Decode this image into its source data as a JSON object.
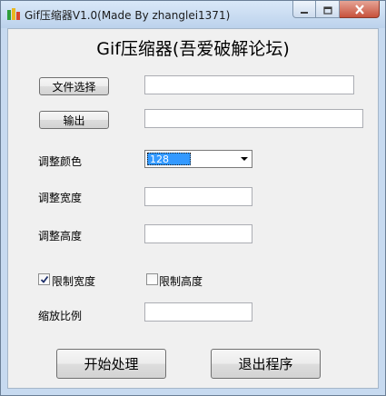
{
  "window": {
    "title": "Gif压缩器V1.0(Made By zhanglei1371)"
  },
  "heading": "Gif压缩器(吾爱破解论坛)",
  "buttons": {
    "select_file": "文件选择",
    "output": "输出",
    "start": "开始处理",
    "exit": "退出程序"
  },
  "fields": {
    "input_path": "",
    "output_path": "",
    "width": "",
    "height": "",
    "scale": ""
  },
  "labels": {
    "color": "调整颜色",
    "width": "调整宽度",
    "height": "调整高度",
    "scale": "缩放比例"
  },
  "color_select": {
    "value": "128"
  },
  "checkboxes": {
    "limit_width": {
      "label": "限制宽度",
      "checked": true
    },
    "limit_height": {
      "label": "限制高度",
      "checked": false
    }
  },
  "icons": {
    "app": "app-icon",
    "minimize": "minimize-icon",
    "maximize": "maximize-icon",
    "close": "close-icon",
    "dropdown": "chevron-down-icon",
    "check": "check-icon"
  },
  "colors": {
    "titlebar": "#c7daf0",
    "close_button": "#c7513c",
    "selection": "#3399ff"
  }
}
